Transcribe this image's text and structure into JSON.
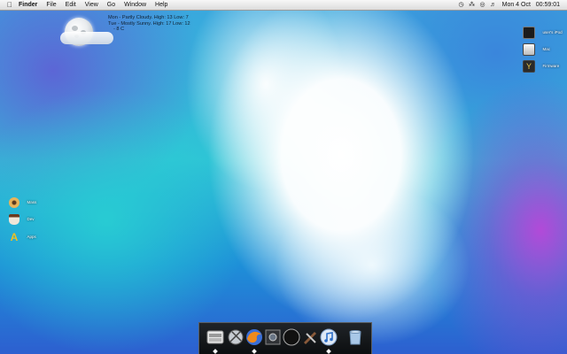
{
  "menubar": {
    "apple_icon": "apple-logo-icon",
    "items": [
      "Finder",
      "File",
      "Edit",
      "View",
      "Go",
      "Window",
      "Help"
    ],
    "status_icons": [
      "time-machine-icon",
      "bluetooth-icon",
      "wifi-icon",
      "volume-icon"
    ],
    "clock_date": "Mon 4 Oct",
    "clock_time": "00:59:01"
  },
  "weather": {
    "icon": "moon-cloud-icon",
    "line1": "Mon - Partly Cloudy. High: 13 Low: 7",
    "line2": "Tue - Mostly Sunny. High: 17 Low: 12",
    "line3": "- 8 C"
  },
  "desktop_right": [
    {
      "label": "user's iPod",
      "icon": "ipod-icon"
    },
    {
      "label": "Mac",
      "icon": "hard-drive-icon"
    },
    {
      "label": "Firmware",
      "icon": "firmware-disk-icon"
    }
  ],
  "desktop_left": [
    {
      "label": "Mass",
      "icon": "donut-icon"
    },
    {
      "label": "Dev",
      "icon": "coffee-cup-icon"
    },
    {
      "label": "Apps",
      "icon": "applications-icon"
    }
  ],
  "dock": {
    "items": [
      {
        "name": "dock-item-finder",
        "icon": "finder-icon",
        "running": true
      },
      {
        "name": "dock-item-mail",
        "icon": "mail-icon",
        "running": false
      },
      {
        "name": "dock-item-firefox",
        "icon": "firefox-icon",
        "running": true
      },
      {
        "name": "dock-item-preview",
        "icon": "preview-icon",
        "running": false
      },
      {
        "name": "dock-item-camino",
        "icon": "camino-icon",
        "running": false
      },
      {
        "name": "dock-item-utilities",
        "icon": "utilities-icon",
        "running": false
      },
      {
        "name": "dock-item-itunes",
        "icon": "itunes-icon",
        "running": true
      },
      {
        "name": "dock-item-trash",
        "icon": "trash-icon",
        "running": false
      }
    ]
  }
}
